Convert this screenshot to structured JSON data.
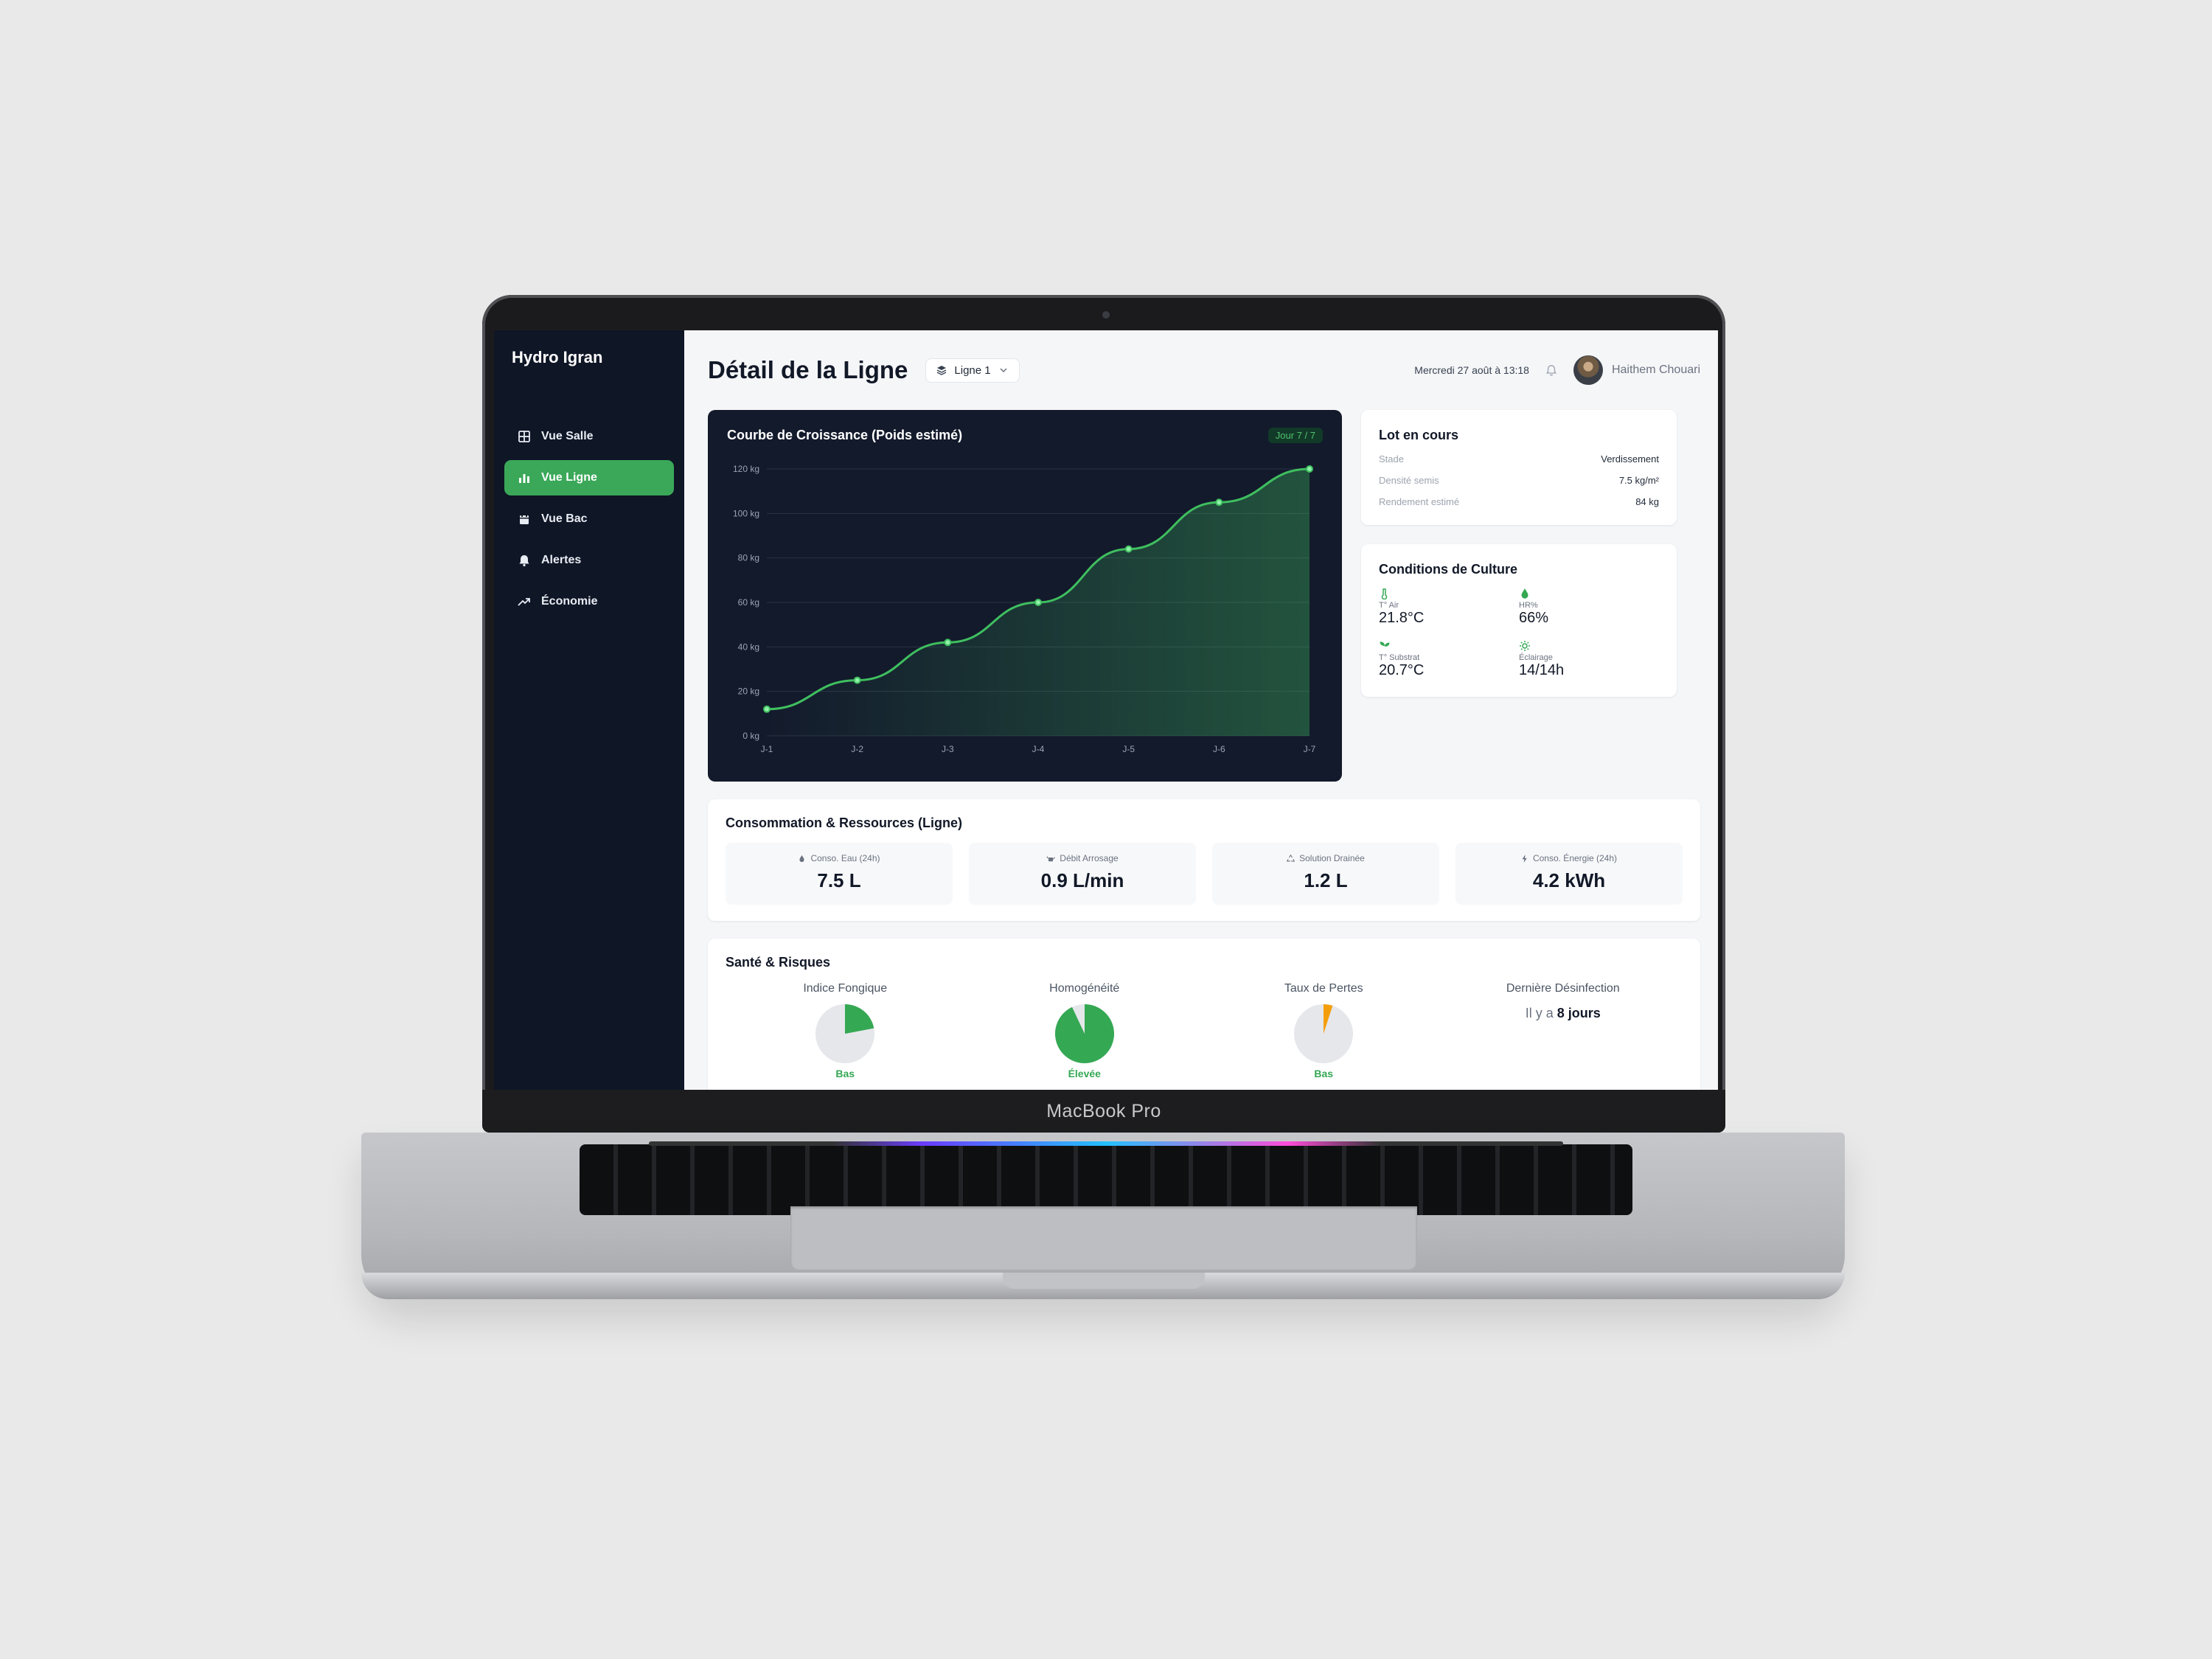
{
  "device": {
    "label": "MacBook Pro"
  },
  "sidebar": {
    "brand": "Hydro Igran",
    "items": [
      {
        "label": "Vue Salle",
        "icon": "grid-icon",
        "active": false
      },
      {
        "label": "Vue Ligne",
        "icon": "bar-chart-icon",
        "active": true
      },
      {
        "label": "Vue Bac",
        "icon": "calendar-icon",
        "active": false
      },
      {
        "label": "Alertes",
        "icon": "bell-icon",
        "active": false
      },
      {
        "label": "Économie",
        "icon": "trend-up-icon",
        "active": false
      }
    ]
  },
  "header": {
    "title": "Détail de la Ligne",
    "line_select": "Ligne 1",
    "datetime": "Mercredi 27 août à 13:18",
    "user": "Haithem Chouari"
  },
  "growth": {
    "title": "Courbe de Croissance (Poids estimé)",
    "badge": "Jour 7 / 7"
  },
  "chart_data": {
    "type": "area",
    "x": [
      "J-1",
      "J-2",
      "J-3",
      "J-4",
      "J-5",
      "J-6",
      "J-7"
    ],
    "values": [
      12,
      25,
      42,
      60,
      84,
      105,
      120
    ],
    "yticks": [
      "0 kg",
      "20 kg",
      "40 kg",
      "60 kg",
      "80 kg",
      "100 kg",
      "120 kg"
    ],
    "ylim": [
      0,
      120
    ],
    "grid": true,
    "color": "#3fbf5f"
  },
  "lot": {
    "title": "Lot en cours",
    "rows": [
      {
        "k": "Stade",
        "v": "Verdissement"
      },
      {
        "k": "Densité semis",
        "v": "7.5 kg/m²"
      },
      {
        "k": "Rendement estimé",
        "v": "84 kg"
      }
    ]
  },
  "conditions": {
    "title": "Conditions de Culture",
    "items": [
      {
        "label": "T° Air",
        "value": "21.8°C",
        "icon": "thermometer-icon"
      },
      {
        "label": "HR%",
        "value": "66%",
        "icon": "droplet-icon"
      },
      {
        "label": "T° Substrat",
        "value": "20.7°C",
        "icon": "sprout-icon"
      },
      {
        "label": "Éclairage",
        "value": "14/14h",
        "icon": "sun-icon"
      }
    ]
  },
  "resources": {
    "title": "Consommation & Ressources (Ligne)",
    "tiles": [
      {
        "label": "Conso. Eau (24h)",
        "value": "7.5 L",
        "icon": "droplet-icon"
      },
      {
        "label": "Débit Arrosage",
        "value": "0.9 L/min",
        "icon": "watering-can-icon"
      },
      {
        "label": "Solution Drainée",
        "value": "1.2 L",
        "icon": "recycle-icon"
      },
      {
        "label": "Conso. Énergie (24h)",
        "value": "4.2 kWh",
        "icon": "bolt-icon"
      }
    ]
  },
  "health": {
    "title": "Santé & Risques",
    "metrics": [
      {
        "label": "Indice Fongique",
        "fraction": 0.22,
        "color": "#34a853",
        "caption": "Bas"
      },
      {
        "label": "Homogénéité",
        "fraction": 0.93,
        "color": "#34a853",
        "caption": "Élevée"
      },
      {
        "label": "Taux de Pertes",
        "fraction": 0.05,
        "color": "#f59e0b",
        "caption": "Bas"
      }
    ],
    "disinfection": {
      "label": "Dernière Désinfection",
      "prefix": "Il y a",
      "value": "8 jours"
    }
  },
  "colors": {
    "accent": "#3aa858",
    "sidebar": "#0f1626",
    "chart_bg": "#131a2c"
  }
}
